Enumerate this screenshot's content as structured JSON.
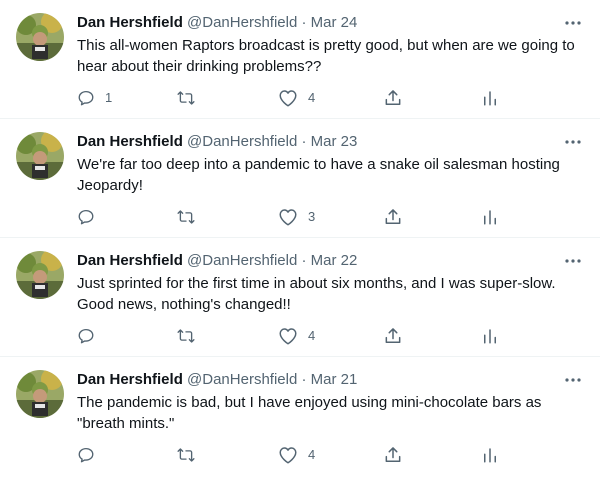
{
  "tweets": [
    {
      "author": "Dan Hershfield",
      "handle": "@DanHershfield",
      "separator": "·",
      "date": "Mar 24",
      "text": "This all-women Raptors broadcast is pretty good, but when are we going to hear about their drinking problems??",
      "reply_count": "1",
      "retweet_count": "",
      "like_count": "4"
    },
    {
      "author": "Dan Hershfield",
      "handle": "@DanHershfield",
      "separator": "·",
      "date": "Mar 23",
      "text": "We're far too deep into a pandemic to have a snake oil salesman hosting Jeopardy!",
      "reply_count": "",
      "retweet_count": "",
      "like_count": "3"
    },
    {
      "author": "Dan Hershfield",
      "handle": "@DanHershfield",
      "separator": "·",
      "date": "Mar 22",
      "text": "Just sprinted for the first time in about six months, and I was super-slow. Good news, nothing's changed!!",
      "reply_count": "",
      "retweet_count": "",
      "like_count": "4"
    },
    {
      "author": "Dan Hershfield",
      "handle": "@DanHershfield",
      "separator": "·",
      "date": "Mar 21",
      "text": "The pandemic is bad, but I have enjoyed using mini-chocolate bars as \"breath mints.\"",
      "reply_count": "",
      "retweet_count": "",
      "like_count": "4"
    }
  ],
  "icons": {
    "more": "more-icon",
    "reply": "reply-icon",
    "retweet": "retweet-icon",
    "like": "heart-icon",
    "share": "share-icon",
    "analytics": "analytics-icon"
  },
  "colors": {
    "text": "#0f1419",
    "secondary": "#536471",
    "divider": "#eff3f4"
  }
}
